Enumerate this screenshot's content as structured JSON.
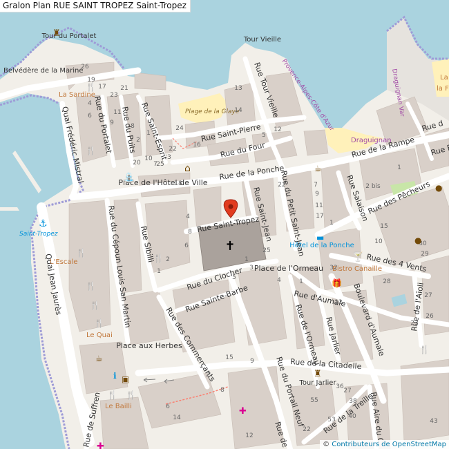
{
  "title": "Gralon Plan RUE SAINT TROPEZ Saint-Tropez",
  "attribution": {
    "prefix": "© ",
    "link": "Contributeurs de OpenStreetMap"
  },
  "colors": {
    "water": "#aad3df",
    "land": "#f2efe9",
    "building": "#d9d0c9",
    "road": "#ffffff",
    "beach": "#fff1ba",
    "church": "#aaa29c",
    "boundary": "#9e9bd7",
    "marker": "#e13b1f",
    "poi": "#734a08",
    "green": "#c8e6a8"
  },
  "labels": {
    "tour_portalet": "Tour du Portalet",
    "tour_vieille": "Tour Vieille",
    "belvedere": "Belvédère de la Marine",
    "la_sardine": "La Sardine",
    "plage_glaye": "Plage de la Glaye",
    "quai_mistral": "Quai Frédéric Mistral",
    "rue_portalet": "Rue du Portalet",
    "rue_puits": "Rue du Puits",
    "rue_saint_esprit": "Rue Saint-Esprit",
    "rue_saint_pierre": "Rue Saint-Pierre",
    "rue_four": "Rue du Four",
    "rue_tour_vieille": "Rue Tour Vieille",
    "rue_ponche": "Rue de la Ponche",
    "rue_rampe": "Rue de la Rampe",
    "rue_font": "Rue Font",
    "rue_fr": "Rue d",
    "place_hotel_ville": "Place de l'Hôtel de Ville",
    "rue_saint_tropez": "Rue Saint-Tropez",
    "rue_saint_jean": "Rue Saint-Jean",
    "rue_petit_saint_jean": "Rue du Petit Saint-Jean",
    "rue_salaison": "Rue Salaison",
    "rue_pecheurs": "Rue des Pêcheurs",
    "hotel_ponche": "Hôtel de la Ponche",
    "draguignan": "Draguignan",
    "provence": "Provence-Alpes-Côte d'Azur",
    "draguignan_var": "Draguignan Var",
    "saint_tropez_port": "Saint-Tropez",
    "rue_capoun": "Rue du Cépoun Louis San Martin",
    "rue_sibilli": "Rue Sibilli",
    "lescale": "L'Escale",
    "quai_jaures": "Quai Jean Jaurès",
    "le_quai": "Le Quai",
    "rue_clocher": "Rue du Clocher",
    "rue_sainte_barbe": "Rue Sainte-Barbe",
    "rue_commercants": "Rue des Commerçants",
    "place_ormeau": "Place de l'Ormeau",
    "rue_aumale": "Rue d'Aumale",
    "rue_ormeau": "Rue de l'Ormeau",
    "rue_jarlier": "Rue Jarlier",
    "boulevard_aumale": "Boulevard d'Aumale",
    "rue_4_vents": "Rue des 4 Vents",
    "bistro": "Bistro Canaille",
    "rue_aioli": "Rue de l'Aïoli",
    "place_herbes": "Place aux Herbes",
    "rue_citadelle": "Rue de la Citadelle",
    "tour_jarlier": "Tour Jarlier",
    "rue_portail_neuf": "Rue du Portail Neuf",
    "rue_treille": "Rue de la Treille",
    "rue_aire": "Rue Aire du C",
    "le_bailli": "Le Bailli",
    "rue_suffren": "Rue de Suffren",
    "rue_de": "Rue de",
    "la_fr": "La",
    "la_fr2": "la Fr"
  },
  "house_numbers": [
    "26",
    "19",
    "17",
    "23",
    "21",
    "4",
    "6",
    "11",
    "9",
    "8",
    "2",
    "1",
    "24",
    "22",
    "25",
    "16",
    "14",
    "13",
    "12",
    "5",
    "7",
    "3",
    "10",
    "20",
    "18",
    "4",
    "8",
    "6",
    "2",
    "1",
    "2 bis",
    "7",
    "9",
    "11",
    "17",
    "1",
    "32",
    "15",
    "10",
    "30",
    "29",
    "28",
    "27",
    "26",
    "23",
    "12",
    "1",
    "4",
    "22",
    "25",
    "1",
    "3",
    "5",
    "2",
    "36",
    "27",
    "55",
    "53",
    "38",
    "40",
    "43",
    "15",
    "9",
    "8",
    "6",
    "14",
    "12",
    "22",
    "1"
  ]
}
